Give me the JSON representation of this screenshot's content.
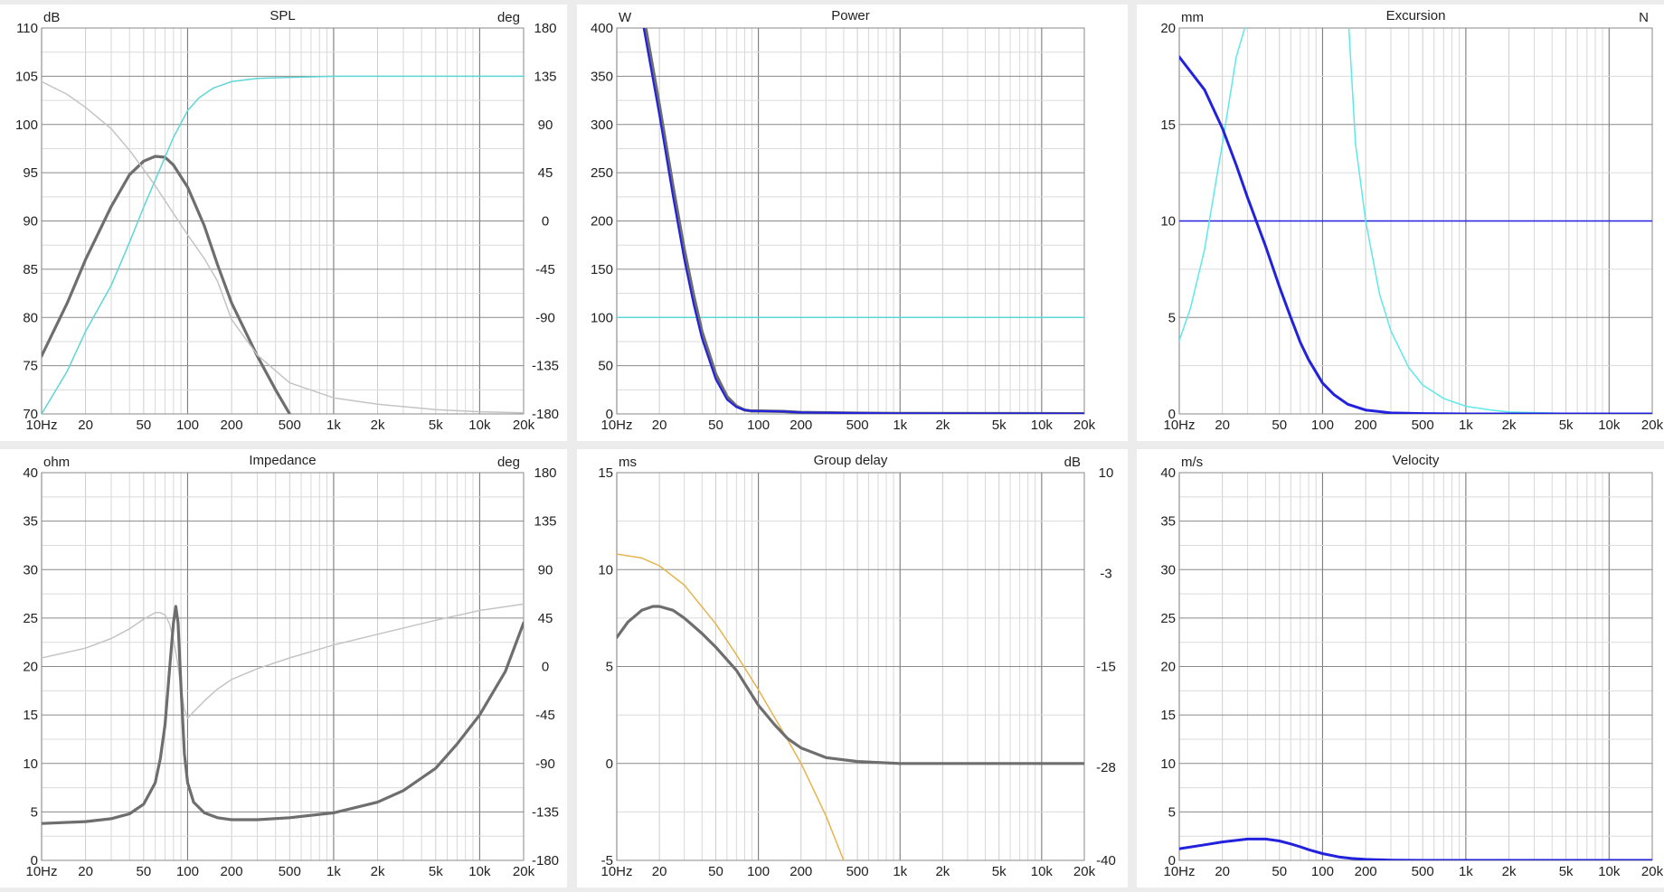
{
  "chart_data": [
    {
      "type": "line",
      "title": "SPL",
      "ylabel": "dB",
      "y2label": "deg",
      "xscale": "log",
      "xlim": [
        10,
        20000
      ],
      "ylim": [
        70,
        110
      ],
      "y2lim": [
        -180,
        180
      ],
      "xticks": [
        10,
        20,
        50,
        100,
        200,
        500,
        1000,
        2000,
        5000,
        10000,
        20000
      ],
      "xticklabels": [
        "10Hz",
        "20",
        "50",
        "100",
        "200",
        "500",
        "1k",
        "2k",
        "5k",
        "10k",
        "20k"
      ],
      "yticks": [
        70,
        75,
        80,
        85,
        90,
        95,
        100,
        105,
        110
      ],
      "y2ticks": [
        -180,
        -135,
        -90,
        -45,
        0,
        45,
        90,
        135,
        180
      ],
      "grid": true,
      "series": [
        {
          "color": "#6e6e6e",
          "width": 3.2,
          "axis": "y",
          "x": [
            10,
            15,
            20,
            30,
            40,
            50,
            60,
            70,
            80,
            100,
            130,
            160,
            200,
            300,
            400,
            500
          ],
          "y": [
            76,
            81.5,
            86,
            91.5,
            94.8,
            96.2,
            96.7,
            96.6,
            95.8,
            93.5,
            89.5,
            85.5,
            81.5,
            76,
            72.5,
            70
          ]
        },
        {
          "color": "#5fd6d6",
          "width": 1.5,
          "axis": "y2",
          "x": [
            10,
            15,
            20,
            30,
            40,
            50,
            60,
            80,
            100,
            120,
            150,
            200,
            300,
            500,
            1000,
            20000
          ],
          "y": [
            -180,
            -140,
            -103,
            -60,
            -20,
            13,
            38,
            78,
            103,
            115,
            124,
            130,
            133,
            134,
            135,
            135
          ]
        },
        {
          "color": "#c4c4c4",
          "width": 1.5,
          "axis": "y2",
          "x": [
            10,
            15,
            20,
            30,
            40,
            50,
            60,
            80,
            100,
            130,
            160,
            200,
            300,
            500,
            1000,
            2000,
            5000,
            10000,
            20000
          ],
          "y": [
            130,
            118,
            106,
            86,
            66,
            48,
            33,
            7,
            -13,
            -35,
            -56,
            -92,
            -125,
            -151,
            -165,
            -171,
            -176,
            -178,
            -179
          ]
        }
      ]
    },
    {
      "type": "line",
      "title": "Power",
      "ylabel": "W",
      "xscale": "log",
      "xlim": [
        10,
        20000
      ],
      "ylim": [
        0,
        400
      ],
      "xticks": [
        10,
        20,
        50,
        100,
        200,
        500,
        1000,
        2000,
        5000,
        10000,
        20000
      ],
      "xticklabels": [
        "10Hz",
        "20",
        "50",
        "100",
        "200",
        "500",
        "1k",
        "2k",
        "5k",
        "10k",
        "20k"
      ],
      "yticks": [
        0,
        50,
        100,
        150,
        200,
        250,
        300,
        350,
        400
      ],
      "grid": true,
      "series": [
        {
          "color": "#5fd6d6",
          "width": 1.5,
          "axis": "y",
          "x": [
            10,
            20000
          ],
          "y": [
            100,
            100
          ]
        },
        {
          "color": "#6e6e6e",
          "width": 3.5,
          "axis": "y",
          "x": [
            16,
            20,
            25,
            30,
            35,
            40,
            50,
            60,
            70,
            80,
            90,
            100,
            150,
            200,
            500,
            1000,
            20000
          ],
          "y": [
            400,
            320,
            235,
            170,
            122,
            85,
            41,
            18,
            8,
            4,
            3,
            3,
            2.5,
            1.5,
            0.8,
            0.5,
            0.3
          ]
        },
        {
          "color": "#2222dd",
          "width": 2.2,
          "axis": "y",
          "x": [
            15.5,
            20,
            25,
            30,
            35,
            40,
            50,
            60,
            70,
            80,
            90,
            100,
            150,
            200,
            500,
            1000,
            20000
          ],
          "y": [
            400,
            310,
            225,
            160,
            113,
            78,
            36,
            15,
            7,
            4,
            3,
            3,
            2.5,
            1.5,
            0.8,
            0.5,
            0.3
          ]
        }
      ]
    },
    {
      "type": "line",
      "title": "Excursion",
      "ylabel": "mm",
      "y2label": "N",
      "xscale": "log",
      "xlim": [
        10,
        20000
      ],
      "ylim": [
        0,
        20
      ],
      "xticks": [
        10,
        20,
        50,
        100,
        200,
        500,
        1000,
        2000,
        5000,
        10000,
        20000
      ],
      "xticklabels": [
        "10Hz",
        "20",
        "50",
        "100",
        "200",
        "500",
        "1k",
        "2k",
        "5k",
        "10k",
        "20k"
      ],
      "yticks": [
        0,
        5,
        10,
        15,
        20
      ],
      "grid": true,
      "series": [
        {
          "color": "#2222dd",
          "width": 1.5,
          "axis": "y",
          "x": [
            10,
            20000
          ],
          "y": [
            10,
            10
          ]
        },
        {
          "color": "#5fe8e8",
          "width": 1.5,
          "axis": "y",
          "x": [
            10,
            12,
            15,
            18,
            20,
            25,
            30,
            35
          ],
          "y": [
            3.8,
            5.5,
            8.5,
            12,
            14,
            18.5,
            20.5,
            21
          ]
        },
        {
          "color": "#5fe8e8",
          "width": 1.5,
          "axis": "y",
          "x": [
            150,
            170,
            200,
            250,
            300,
            400,
            500,
            700,
            1000,
            1500,
            2000,
            5000,
            20000
          ],
          "y": [
            21,
            14,
            10,
            6.2,
            4.3,
            2.4,
            1.5,
            0.8,
            0.4,
            0.2,
            0.1,
            0.03,
            0.01
          ]
        },
        {
          "color": "#2222dd",
          "width": 3,
          "axis": "y",
          "x": [
            10,
            15,
            20,
            25,
            30,
            40,
            50,
            60,
            70,
            80,
            100,
            120,
            150,
            200,
            300,
            500,
            1000,
            20000
          ],
          "y": [
            18.5,
            16.8,
            14.8,
            12.9,
            11.2,
            8.7,
            6.6,
            5,
            3.7,
            2.8,
            1.6,
            1,
            0.5,
            0.2,
            0.05,
            0.02,
            0,
            0
          ]
        }
      ]
    },
    {
      "type": "line",
      "title": "Impedance",
      "ylabel": "ohm",
      "y2label": "deg",
      "xscale": "log",
      "xlim": [
        10,
        20000
      ],
      "ylim": [
        0,
        40
      ],
      "y2lim": [
        -180,
        180
      ],
      "xticks": [
        10,
        20,
        50,
        100,
        200,
        500,
        1000,
        2000,
        5000,
        10000,
        20000
      ],
      "xticklabels": [
        "10Hz",
        "20",
        "50",
        "100",
        "200",
        "500",
        "1k",
        "2k",
        "5k",
        "10k",
        "20k"
      ],
      "yticks": [
        0,
        5,
        10,
        15,
        20,
        25,
        30,
        35,
        40
      ],
      "y2ticks": [
        -180,
        -135,
        -90,
        -45,
        0,
        45,
        90,
        135,
        180
      ],
      "grid": true,
      "series": [
        {
          "color": "#c4c4c4",
          "width": 1.5,
          "axis": "y2",
          "x": [
            10,
            20,
            30,
            40,
            50,
            60,
            65,
            70,
            75,
            80,
            85,
            90,
            95,
            100,
            110,
            130,
            160,
            200,
            300,
            500,
            1000,
            2000,
            5000,
            10000,
            20000
          ],
          "y": [
            8,
            17,
            26,
            35,
            44,
            50,
            50,
            48,
            40,
            25,
            5,
            -20,
            -40,
            -48,
            -42,
            -32,
            -21,
            -12,
            -2,
            8,
            20,
            30,
            43,
            52,
            58
          ]
        },
        {
          "color": "#6e6e6e",
          "width": 3.2,
          "axis": "y",
          "x": [
            10,
            20,
            30,
            40,
            50,
            60,
            65,
            70,
            75,
            80,
            83,
            86,
            90,
            95,
            100,
            110,
            130,
            160,
            200,
            300,
            500,
            1000,
            2000,
            3000,
            5000,
            7000,
            10000,
            15000,
            20000
          ],
          "y": [
            3.8,
            4,
            4.3,
            4.8,
            5.8,
            8,
            10.5,
            14,
            19.5,
            24.5,
            26.2,
            24.5,
            18,
            11,
            8,
            6,
            4.9,
            4.4,
            4.2,
            4.2,
            4.4,
            4.9,
            6,
            7.2,
            9.5,
            12,
            15,
            19.5,
            24.5
          ]
        }
      ]
    },
    {
      "type": "line",
      "title": "Group delay",
      "ylabel": "ms",
      "y2label": "dB",
      "xscale": "log",
      "xlim": [
        10,
        20000
      ],
      "ylim": [
        -5,
        15
      ],
      "y2lim": [
        -40,
        10
      ],
      "xticks": [
        10,
        20,
        50,
        100,
        200,
        500,
        1000,
        2000,
        5000,
        10000,
        20000
      ],
      "xticklabels": [
        "10Hz",
        "20",
        "50",
        "100",
        "200",
        "500",
        "1k",
        "2k",
        "5k",
        "10k",
        "20k"
      ],
      "yticks": [
        -5,
        0,
        5,
        10,
        15
      ],
      "y2ticks": [
        -40,
        -28,
        -15,
        -3,
        10
      ],
      "grid": true,
      "series": [
        {
          "color": "#e6b44c",
          "width": 1.5,
          "axis": "y",
          "x": [
            10,
            15,
            20,
            30,
            50,
            70,
            100,
            150,
            200,
            300,
            400
          ],
          "y": [
            10.8,
            10.6,
            10.2,
            9.2,
            7.2,
            5.6,
            3.8,
            1.6,
            0,
            -2.7,
            -5
          ]
        },
        {
          "color": "#6e6e6e",
          "width": 3.2,
          "axis": "y",
          "x": [
            10,
            12,
            15,
            18,
            20,
            25,
            30,
            40,
            50,
            70,
            100,
            130,
            160,
            200,
            300,
            500,
            1000,
            2000,
            20000
          ],
          "y": [
            6.5,
            7.3,
            7.9,
            8.1,
            8.1,
            7.9,
            7.5,
            6.7,
            6,
            4.8,
            3,
            2,
            1.3,
            0.8,
            0.3,
            0.1,
            0,
            0,
            0
          ]
        }
      ]
    },
    {
      "type": "line",
      "title": "Velocity",
      "ylabel": "m/s",
      "xscale": "log",
      "xlim": [
        10,
        20000
      ],
      "ylim": [
        0,
        40
      ],
      "xticks": [
        10,
        20,
        50,
        100,
        200,
        500,
        1000,
        2000,
        5000,
        10000,
        20000
      ],
      "xticklabels": [
        "10Hz",
        "20",
        "50",
        "100",
        "200",
        "500",
        "1k",
        "2k",
        "5k",
        "10k",
        "20k"
      ],
      "yticks": [
        0,
        5,
        10,
        15,
        20,
        25,
        30,
        35,
        40
      ],
      "grid": true,
      "series": [
        {
          "color": "#2222dd",
          "width": 3,
          "axis": "y",
          "x": [
            10,
            15,
            20,
            30,
            40,
            50,
            60,
            70,
            80,
            100,
            130,
            160,
            200,
            300,
            500,
            1000,
            20000
          ],
          "y": [
            1.2,
            1.6,
            1.9,
            2.2,
            2.2,
            2,
            1.7,
            1.4,
            1.1,
            0.7,
            0.35,
            0.2,
            0.1,
            0.03,
            0,
            0,
            0
          ]
        }
      ]
    }
  ]
}
